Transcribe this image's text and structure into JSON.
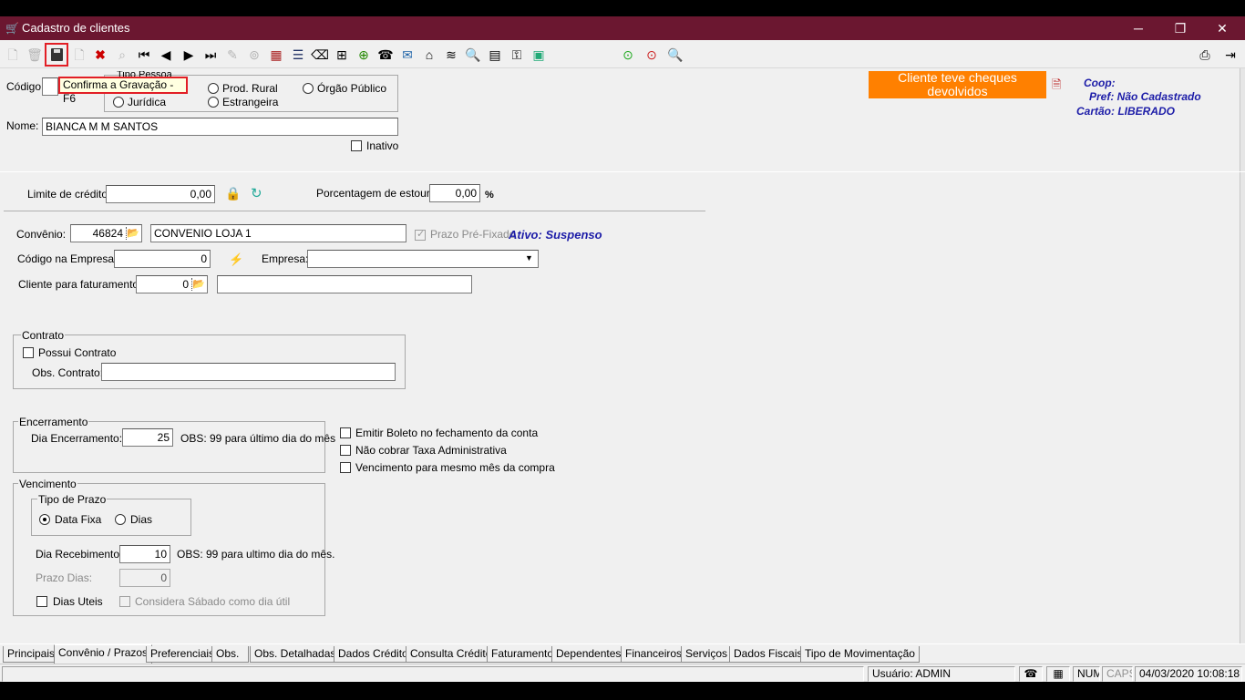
{
  "window": {
    "title": "Cadastro de clientes",
    "app_icon": "cart-icon"
  },
  "toolbar": {
    "tooltip": "Confirma a Gravação - F6",
    "icons": [
      "new-icon",
      "delete-icon",
      "save-icon",
      "blank-doc-icon",
      "cancel-icon",
      "search-icon",
      "first-icon",
      "prev-icon",
      "next-icon",
      "last-icon",
      "pen-icon",
      "binoculars-icon",
      "calendar-icon",
      "edit-list-icon",
      "eraser-icon",
      "network-icon",
      "add-doc-icon",
      "phone-icon",
      "envelope-icon",
      "inbox-icon",
      "cash-icon",
      "doc-search-icon",
      "grid-icon",
      "key-icon",
      "money-icon",
      "green-circle-icon",
      "red-circle-icon",
      "magnifier-icon",
      "printer-icon",
      "exit-icon"
    ]
  },
  "header": {
    "codigo_label": "Código:",
    "tipo_pessoa_label": "Tipo Pessoa",
    "tipo_options": [
      "Jurídica",
      "Prod. Rural",
      "Estrangeira",
      "Órgão Público"
    ],
    "nome_label": "Nome:",
    "nome_value": "BIANCA M M SANTOS",
    "inativo_label": "Inativo",
    "alert_text": "Cliente teve cheques devolvidos",
    "coop_label": "Coop:",
    "pref_text": "Pref: Não Cadastrado",
    "cartao_text": "Cartão: LIBERADO"
  },
  "credit": {
    "limite_label": "Limite de crédito:",
    "limite_value": "0,00",
    "estouro_label": "Porcentagem de estouro:",
    "estouro_value": "0,00",
    "percent_sign": "%"
  },
  "convenio": {
    "label": "Convênio:",
    "code": "46824",
    "name": "CONVENIO LOJA 1",
    "prazo_label": "Prazo Pré-Fixado",
    "ativo_text": "Ativo: Suspenso",
    "codigo_empresa_label": "Código na Empresa:",
    "codigo_empresa_value": "0",
    "empresa_label": "Empresa:",
    "empresa_value": "",
    "faturamento_label": "Cliente para faturamento:",
    "faturamento_value": "0"
  },
  "contrato": {
    "title": "Contrato",
    "possui_label": "Possui Contrato",
    "obs_label": "Obs. Contrato:",
    "obs_value": ""
  },
  "encerramento": {
    "title": "Encerramento",
    "dia_label": "Dia Encerramento:",
    "dia_value": "25",
    "obs": "OBS: 99 para último dia do mês"
  },
  "options": [
    "Emitir Boleto no fechamento da conta",
    "Não cobrar Taxa Administrativa",
    "Vencimento para mesmo mês da compra"
  ],
  "vencimento": {
    "title": "Vencimento",
    "tipo_title": "Tipo de Prazo",
    "data_fixa": "Data Fixa",
    "dias": "Dias",
    "dia_receb_label": "Dia Recebimento:",
    "dia_receb_value": "10",
    "dia_receb_obs": "OBS: 99 para ultimo dia do mês.",
    "prazo_dias_label": "Prazo Dias:",
    "prazo_dias_value": "0",
    "dias_uteis": "Dias Uteis",
    "considera_sabado": "Considera Sábado como dia útil"
  },
  "tabs": [
    "Principais",
    "Convênio / Prazos",
    "Preferenciais",
    "Obs.",
    "Obs. Detalhadas",
    "Dados Crédito",
    "Consulta Crédito",
    "Faturamento",
    "Dependentes",
    "Financeiros",
    "Serviços",
    "Dados Fiscais",
    "Tipo de Movimentação"
  ],
  "status": {
    "usuario": "Usuário: ADMIN",
    "num": "NUM",
    "caps": "CAPS",
    "datetime": "04/03/2020 10:08:18"
  },
  "colors": {
    "titlebar": "#6b1730",
    "alert": "#ff8000",
    "highlight": "#e21e25",
    "blue_text": "#1d1da8"
  }
}
